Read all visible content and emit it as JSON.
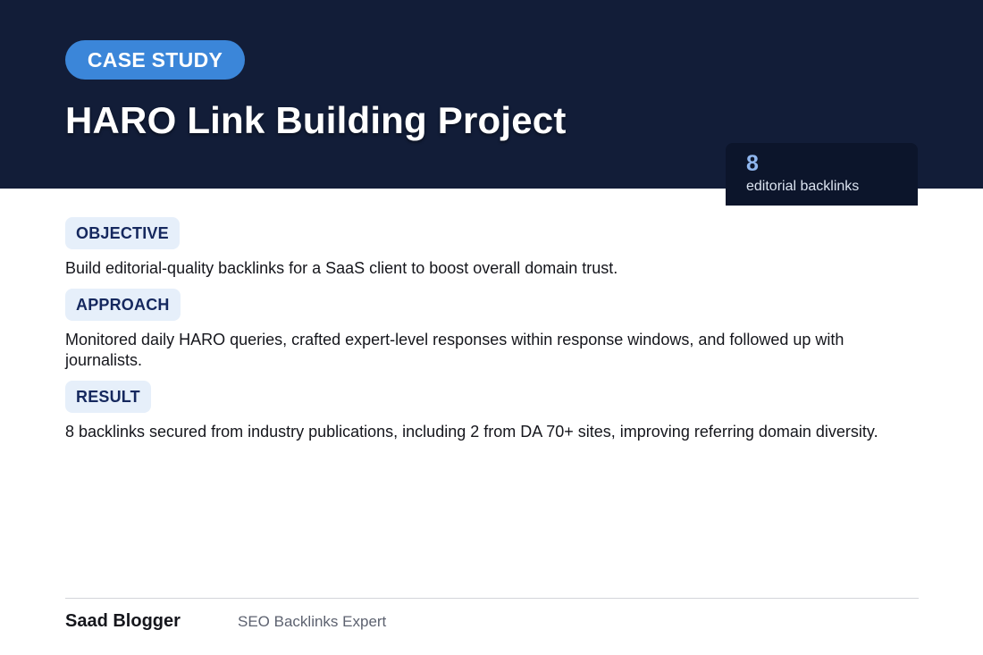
{
  "header": {
    "badge": "CASE STUDY",
    "title": "HARO Link Building Project"
  },
  "stat": {
    "value": "8",
    "label": "editorial backlinks"
  },
  "sections": [
    {
      "heading": "OBJECTIVE",
      "text": "Build editorial-quality backlinks for a SaaS client to boost overall domain trust."
    },
    {
      "heading": "APPROACH",
      "text": "Monitored daily HARO queries, crafted expert-level responses within response windows, and followed up with journalists."
    },
    {
      "heading": "RESULT",
      "text": "8 backlinks secured from industry publications, including 2 from DA 70+ sites, improving referring domain diversity."
    }
  ],
  "footer": {
    "author": "Saad Blogger",
    "role": "SEO Backlinks Expert"
  },
  "colors": {
    "hero_background": "#121d38",
    "badge_background": "#3b86d9",
    "pill_background": "#e6effa",
    "pill_text": "#15285e",
    "stat_value": "#8fb6ee"
  }
}
